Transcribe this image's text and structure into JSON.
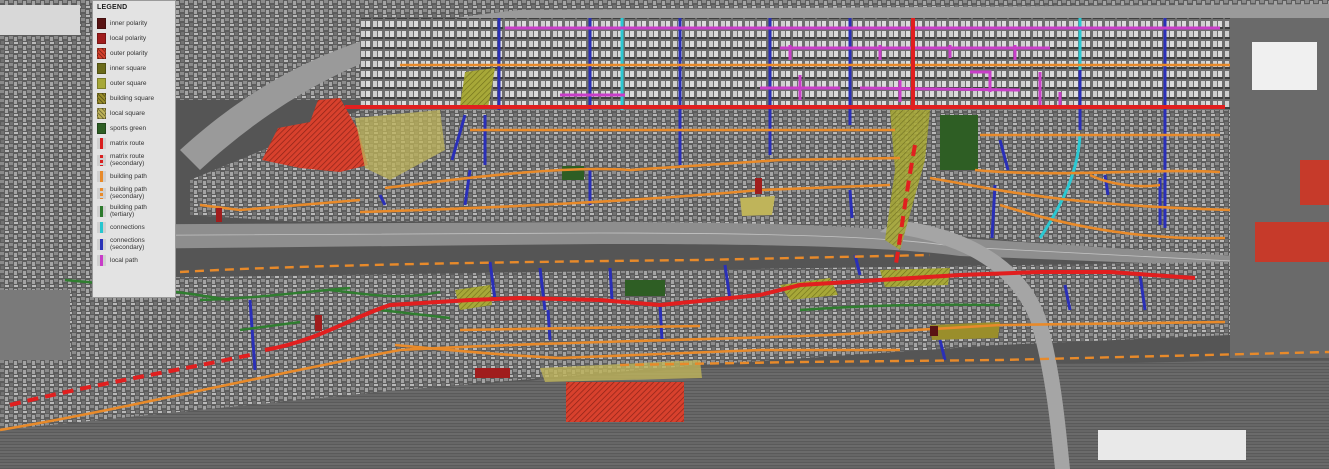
{
  "legend": {
    "title": "LEGEND",
    "items": [
      {
        "label": "inner polarity",
        "color": "#5a1414",
        "kind": "fill"
      },
      {
        "label": "local polarity",
        "color": "#a01d1d",
        "kind": "fill"
      },
      {
        "label": "outer polarity",
        "color": "#d8412d",
        "kind": "hatch"
      },
      {
        "label": "inner square",
        "color": "#6b6b1a",
        "kind": "fill"
      },
      {
        "label": "outer square",
        "color": "#a7a838",
        "kind": "fill"
      },
      {
        "label": "building square",
        "color": "#9a8e2b",
        "kind": "hatch"
      },
      {
        "label": "local square",
        "color": "#bfb45a",
        "kind": "hatch"
      },
      {
        "label": "sports green",
        "color": "#2e5e24",
        "kind": "fill"
      },
      {
        "label": "matrix route",
        "color": "#d91f1f",
        "kind": "line"
      },
      {
        "label": "matrix route (secondary)",
        "color": "#d91f1f",
        "kind": "dashed"
      },
      {
        "label": "building path",
        "color": "#e88a2a",
        "kind": "line"
      },
      {
        "label": "building path (secondary)",
        "color": "#e88a2a",
        "kind": "dashed"
      },
      {
        "label": "building path (tertiary)",
        "color": "#2c7a2c",
        "kind": "line"
      },
      {
        "label": "connections",
        "color": "#26c6cf",
        "kind": "line"
      },
      {
        "label": "connections (secondary)",
        "color": "#2a33b8",
        "kind": "line"
      },
      {
        "label": "local path",
        "color": "#c83cc8",
        "kind": "line"
      }
    ]
  },
  "colors": {
    "matrix_route": "#e11f1f",
    "building_path": "#e88a2a",
    "tertiary_path": "#2f7d2f",
    "connections": "#2bc8d2",
    "connections_secondary": "#2a2fb8",
    "local_path": "#c93ec9",
    "polarity": "#d8412d",
    "square": "#a7a838",
    "green": "#2e5e24"
  }
}
